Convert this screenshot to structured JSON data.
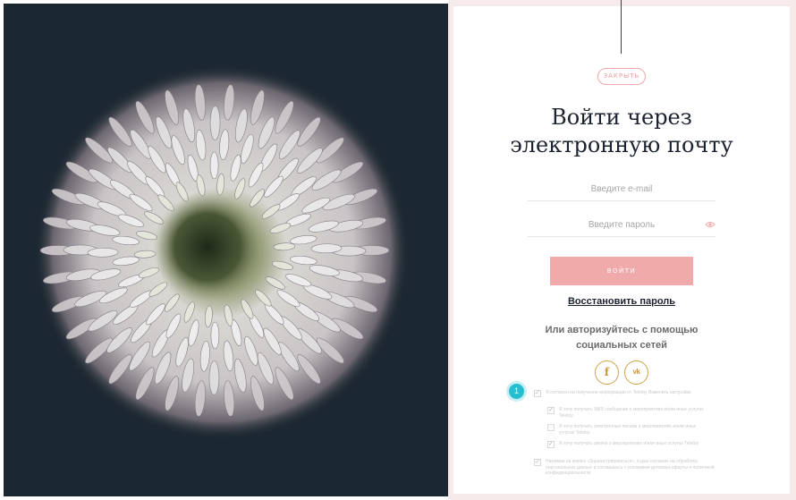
{
  "close_label": "ЗАКРЫТЬ",
  "title_line1": "Войти через",
  "title_line2": "электронную почту",
  "email": {
    "placeholder": "Введите e-mail",
    "value": ""
  },
  "password": {
    "placeholder": "Введите пароль",
    "value": ""
  },
  "login_label": "ВОЙТИ",
  "restore_label": "Восстановить пароль",
  "social_text": "Или авторизуйтесь с помощью социальных сетей",
  "social": {
    "facebook": "f",
    "vk": "vk"
  },
  "hint_number": "1",
  "consents": [
    {
      "text": "Я согласен на получение информации от Teletoy Изменить настройки",
      "checked": true
    },
    {
      "text": "Я хочу получать SMS сообщения о мероприятиях и/или иных услугах Teletoy",
      "checked": true
    },
    {
      "text": "Я хочу получать электронные письма о мероприятиях и/или иных услугах Teletoy",
      "checked": false
    },
    {
      "text": "Я хочу получать звонки о мероприятиях и/или иных услугах Teletoy",
      "checked": true
    },
    {
      "text": "Нажимая на кнопку «Зарегистрироваться», я даю согласие на обработку персональных данных и соглашаюсь с условиями договора-оферты и политикой конфиденциальности",
      "checked": true
    }
  ],
  "colors": {
    "accent": "#f0aaaa",
    "social": "#c8953a",
    "dark_bg": "#1b2731",
    "hint": "#26bfd1"
  }
}
